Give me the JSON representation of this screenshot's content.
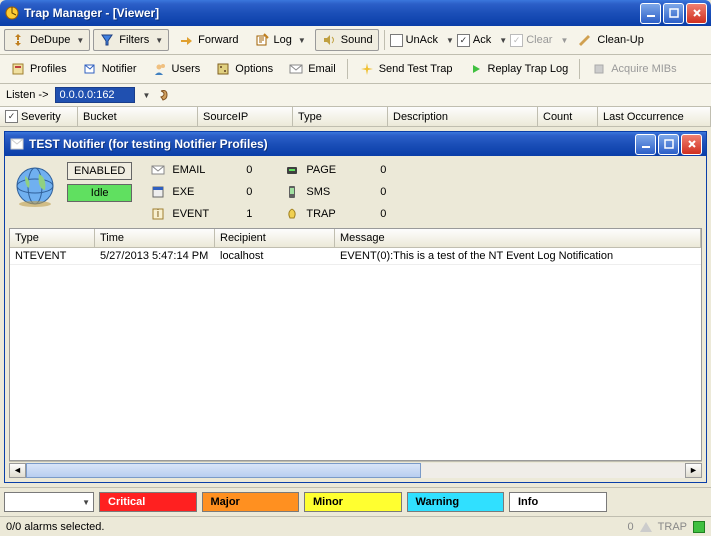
{
  "window": {
    "title": "Trap Manager  -  [Viewer]"
  },
  "toolbar1": {
    "dedupe": "DeDupe",
    "filters": "Filters",
    "forward": "Forward",
    "log": "Log",
    "sound": "Sound",
    "unack": "UnAck",
    "ack": "Ack",
    "clear": "Clear",
    "cleanup": "Clean-Up"
  },
  "toolbar2": {
    "profiles": "Profiles",
    "notifier": "Notifier",
    "users": "Users",
    "options": "Options",
    "email": "Email",
    "sendtest": "Send Test Trap",
    "replay": "Replay Trap Log",
    "acquire": "Acquire MIBs"
  },
  "listen": {
    "label": "Listen ->",
    "value": "0.0.0.0:162"
  },
  "main_columns": {
    "severity": "Severity",
    "bucket": "Bucket",
    "sourceip": "SourceIP",
    "type": "Type",
    "description": "Description",
    "count": "Count",
    "last": "Last Occurrence"
  },
  "notifier": {
    "title": "TEST Notifier (for testing Notifier Profiles)",
    "enabled": "ENABLED",
    "idle": "Idle",
    "counters": {
      "email": {
        "label": "EMAIL",
        "value": "0"
      },
      "exe": {
        "label": "EXE",
        "value": "0"
      },
      "event": {
        "label": "EVENT",
        "value": "1"
      },
      "page": {
        "label": "PAGE",
        "value": "0"
      },
      "sms": {
        "label": "SMS",
        "value": "0"
      },
      "trap": {
        "label": "TRAP",
        "value": "0"
      }
    },
    "columns": {
      "type": "Type",
      "time": "Time",
      "recipient": "Recipient",
      "message": "Message"
    },
    "rows": [
      {
        "type": "NTEVENT",
        "time": "5/27/2013 5:47:14 PM",
        "recipient": "localhost",
        "message": "EVENT(0):This is a test of the NT Event Log Notification"
      }
    ]
  },
  "severity": {
    "critical": "Critical",
    "major": "Major",
    "minor": "Minor",
    "warning": "Warning",
    "info": "Info"
  },
  "status": {
    "selected": "0/0 alarms selected.",
    "zero": "0",
    "trap": "TRAP"
  }
}
